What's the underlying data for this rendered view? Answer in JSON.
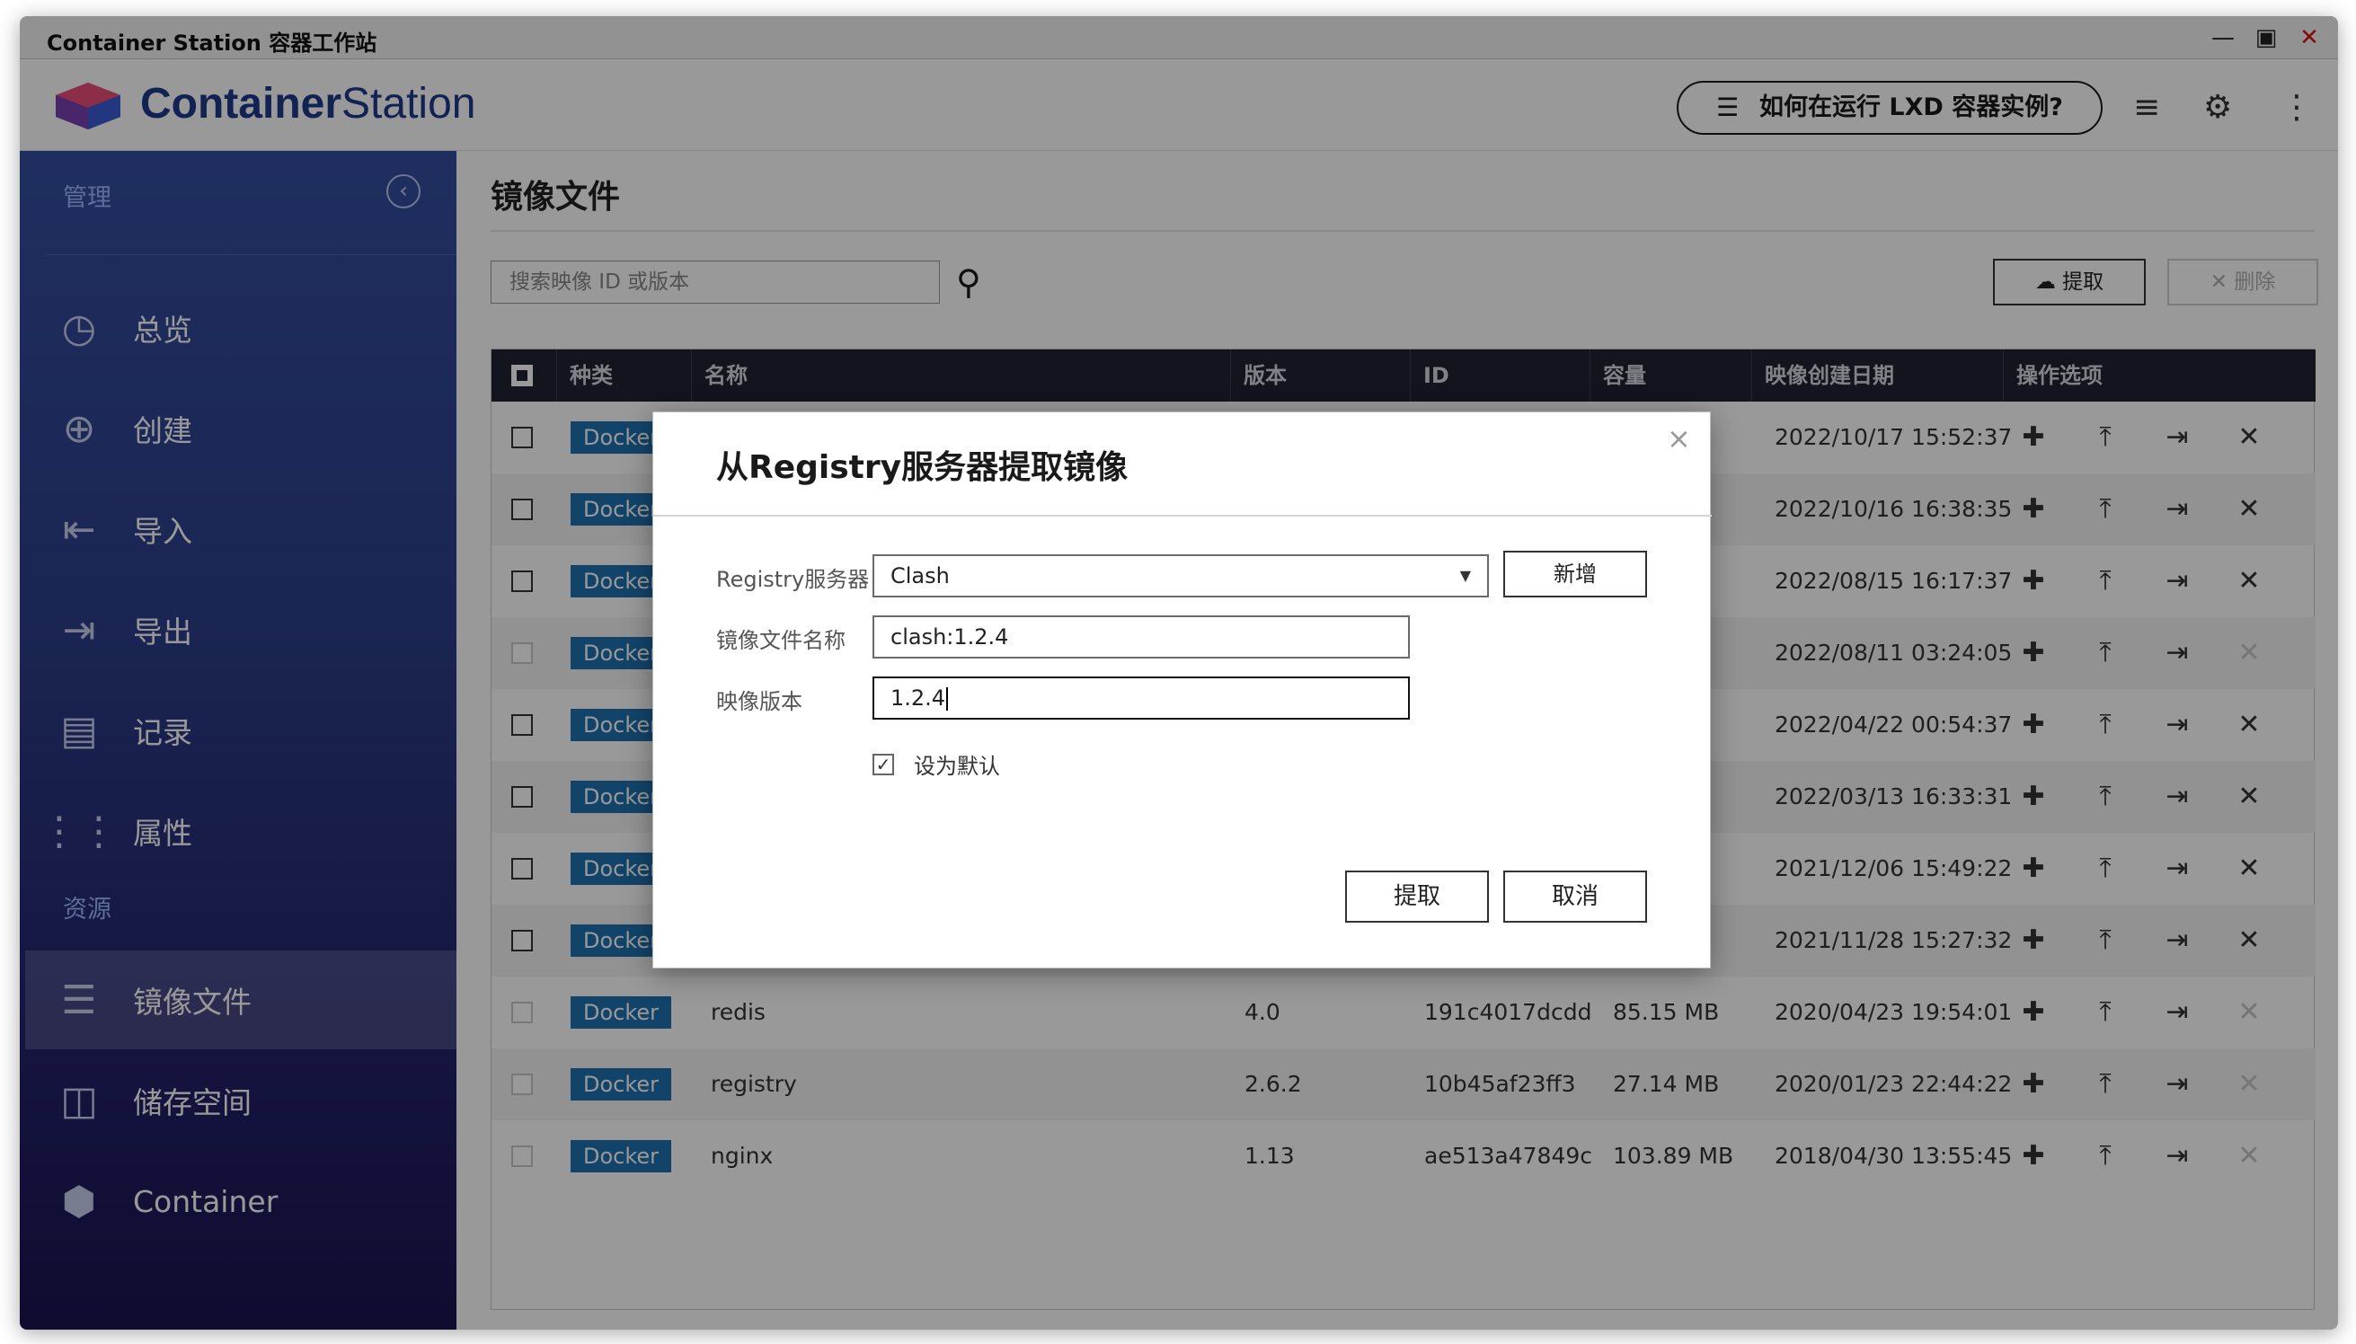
{
  "window": {
    "title": "Container Station 容器工作站"
  },
  "header": {
    "brand_bold": "Container",
    "brand_light": "Station",
    "help_button": "如何在运行 LXD 容器实例?"
  },
  "sidebar": {
    "section_manage": "管理",
    "section_resources": "资源",
    "items": [
      {
        "label": "总览",
        "icon": "gauge-icon"
      },
      {
        "label": "创建",
        "icon": "plus-hexagon-icon"
      },
      {
        "label": "导入",
        "icon": "import-icon"
      },
      {
        "label": "导出",
        "icon": "export-icon"
      },
      {
        "label": "记录",
        "icon": "document-icon"
      },
      {
        "label": "属性",
        "icon": "sliders-icon"
      },
      {
        "label": "镜像文件",
        "icon": "layers-icon"
      },
      {
        "label": "储存空间",
        "icon": "storage-icon"
      },
      {
        "label": "Container",
        "icon": "cube-icon"
      }
    ]
  },
  "main": {
    "title": "镜像文件",
    "search_placeholder": "搜索映像 ID 或版本",
    "pull_button": "提取",
    "delete_button": "删除",
    "columns": [
      "种类",
      "名称",
      "版本",
      "ID",
      "容量",
      "映像创建日期",
      "操作选项"
    ],
    "rows": [
      {
        "type": "Docker",
        "name": "",
        "version": "",
        "id": "",
        "size": "",
        "date": "2022/10/17 15:52:37",
        "deletable": true
      },
      {
        "type": "Docker",
        "name": "",
        "version": "",
        "id": "",
        "size": "",
        "date": "2022/10/16 16:38:35",
        "deletable": true
      },
      {
        "type": "Docker",
        "name": "",
        "version": "",
        "id": "",
        "size": "",
        "date": "2022/08/15 16:17:37",
        "deletable": true
      },
      {
        "type": "Docker",
        "name": "",
        "version": "",
        "id": "",
        "size": "",
        "date": "2022/08/11 03:24:05",
        "deletable": false
      },
      {
        "type": "Docker",
        "name": "",
        "version": "",
        "id": "",
        "size": "",
        "date": "2022/04/22 00:54:37",
        "deletable": true
      },
      {
        "type": "Docker",
        "name": "",
        "version": "",
        "id": "",
        "size": "",
        "date": "2022/03/13 16:33:31",
        "deletable": true
      },
      {
        "type": "Docker",
        "name": "",
        "version": "",
        "id": "",
        "size": "",
        "date": "2021/12/06 15:49:22",
        "deletable": true
      },
      {
        "type": "Docker",
        "name": "",
        "version": "",
        "id": "",
        "size": "",
        "date": "2021/11/28 15:27:32",
        "deletable": true
      },
      {
        "type": "Docker",
        "name": "redis",
        "version": "4.0",
        "id": "191c4017dcdd",
        "size": "85.15 MB",
        "date": "2020/04/23 19:54:01",
        "deletable": false
      },
      {
        "type": "Docker",
        "name": "registry",
        "version": "2.6.2",
        "id": "10b45af23ff3",
        "size": "27.14 MB",
        "date": "2020/01/23 22:44:22",
        "deletable": false
      },
      {
        "type": "Docker",
        "name": "nginx",
        "version": "1.13",
        "id": "ae513a47849c",
        "size": "103.89 MB",
        "date": "2018/04/30 13:55:45",
        "deletable": false
      }
    ]
  },
  "dialog": {
    "title": "从Registry服务器提取镜像",
    "registry_label": "Registry服务器",
    "registry_value": "Clash",
    "add_button": "新增",
    "image_name_label": "镜像文件名称",
    "image_name_value": "clash:1.2.4",
    "version_label": "映像版本",
    "version_value": "1.2.4",
    "default_checkbox_label": "设为默认",
    "default_checked": true,
    "pull_button": "提取",
    "cancel_button": "取消"
  }
}
